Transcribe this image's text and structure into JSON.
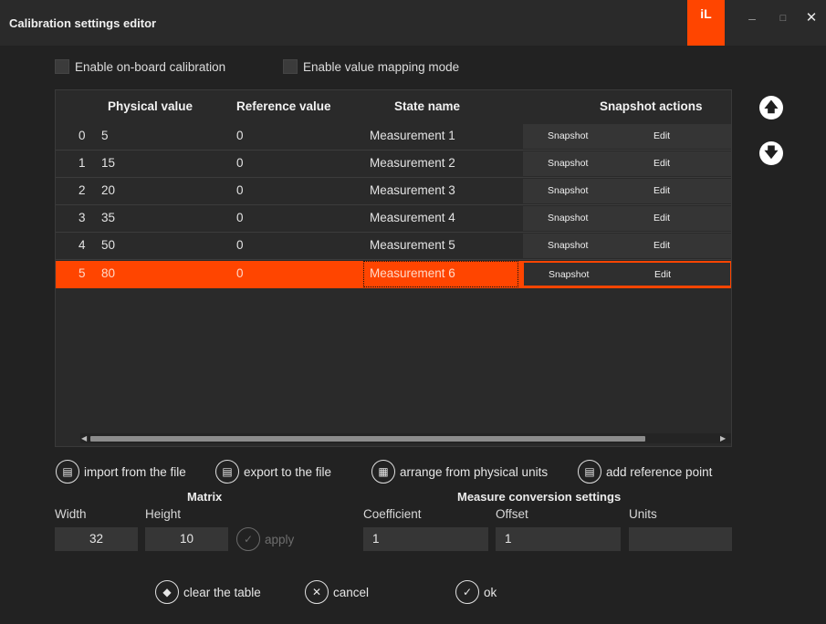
{
  "window": {
    "title": "Calibration settings editor",
    "logo": "iL",
    "minimize_glyph": "–",
    "maximize_glyph": "□",
    "close_glyph": "✕"
  },
  "options": {
    "onboard_label": "Enable on-board calibration",
    "onboard_checked": false,
    "mapping_label": "Enable value mapping mode",
    "mapping_checked": false
  },
  "table": {
    "headers": {
      "physical": "Physical value",
      "reference": "Reference value",
      "state": "State name",
      "actions": "Snapshot actions"
    },
    "snapshot_label": "Snapshot",
    "edit_label": "Edit",
    "selected_row": 5,
    "rows": [
      {
        "index": "0",
        "physical": "5",
        "reference": "0",
        "state": "Measurement 1"
      },
      {
        "index": "1",
        "physical": "15",
        "reference": "0",
        "state": "Measurement 2"
      },
      {
        "index": "2",
        "physical": "20",
        "reference": "0",
        "state": "Measurement 3"
      },
      {
        "index": "3",
        "physical": "35",
        "reference": "0",
        "state": "Measurement 4"
      },
      {
        "index": "4",
        "physical": "50",
        "reference": "0",
        "state": "Measurement 5"
      },
      {
        "index": "5",
        "physical": "80",
        "reference": "0",
        "state": "Measurement 6"
      }
    ]
  },
  "toolbar": {
    "import_label": "import from the file",
    "export_label": "export to the file",
    "arrange_label": "arrange from physical units",
    "add_ref_label": "add reference point"
  },
  "matrix": {
    "title": "Matrix",
    "width_label": "Width",
    "width_value": "32",
    "height_label": "Height",
    "height_value": "10",
    "apply_label": "apply"
  },
  "measure": {
    "title": "Measure conversion settings",
    "coefficient_label": "Coefficient",
    "coefficient_value": "1",
    "offset_label": "Offset",
    "offset_value": "1",
    "units_label": "Units",
    "units_value": ""
  },
  "footer": {
    "clear_label": "clear the table",
    "cancel_label": "cancel",
    "ok_label": "ok"
  },
  "colors": {
    "accent": "#ff4500",
    "background": "#222222",
    "panel": "#2a2a2a"
  },
  "icons": [
    "up-arrow-icon",
    "down-arrow-icon",
    "import-file-icon",
    "export-file-icon",
    "calculator-icon",
    "add-point-icon",
    "checkmark-icon",
    "eraser-icon",
    "cancel-x-icon"
  ]
}
